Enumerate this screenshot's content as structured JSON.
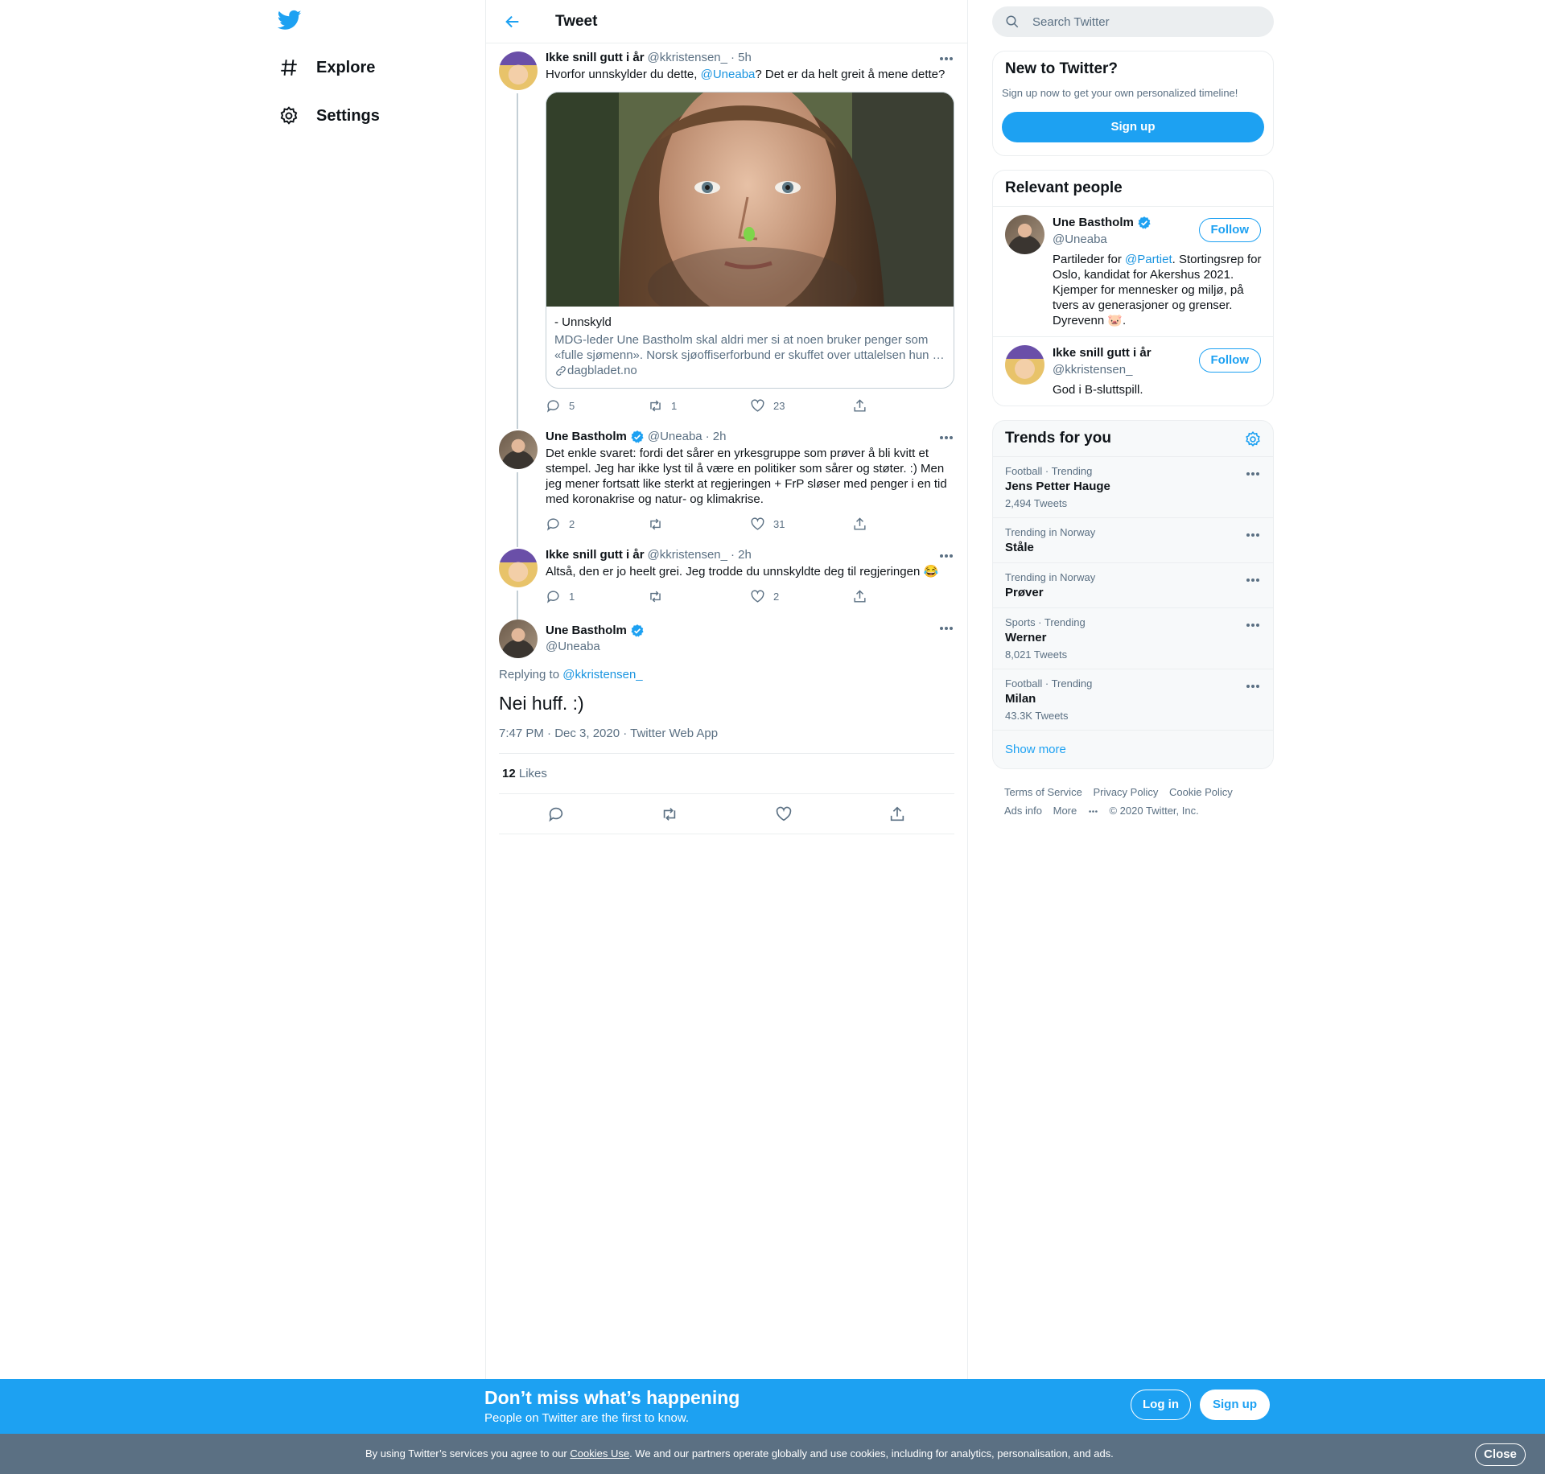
{
  "nav": {
    "explore_label": "Explore",
    "settings_label": "Settings"
  },
  "header": {
    "title": "Tweet"
  },
  "thread": [
    {
      "name": "Ikke snill gutt i år",
      "handle": "@kkristensen_",
      "time": "· 5h",
      "text_before": "Hvorfor unnskylder du dette, ",
      "mention": "@Uneaba",
      "text_after": "? Det er da helt greit å mene dette?",
      "card": {
        "title": "- Unnskyld",
        "description": "MDG-leder Une Bastholm skal aldri mer si at noen bruker penger som «fulle sjømenn». Norsk sjøoffiserforbund er skuffet over uttalelsen hun …",
        "domain": "dagbladet.no"
      },
      "replies": "5",
      "retweets": "1",
      "likes": "23"
    },
    {
      "name": "Une Bastholm",
      "handle": "@Uneaba",
      "time": "· 2h",
      "text": "Det enkle svaret: fordi det sårer en yrkesgruppe som prøver å bli kvitt et stempel. Jeg har ikke lyst til å være en politiker som sårer og støter. :) Men jeg mener fortsatt like sterkt at regjeringen + FrP sløser med penger i en tid med koronakrise og natur- og klimakrise.",
      "replies": "2",
      "retweets": "",
      "likes": "31"
    },
    {
      "name": "Ikke snill gutt i år",
      "handle": "@kkristensen_",
      "time": "· 2h",
      "text": "Altså, den er jo heelt grei. Jeg trodde du unnskyldte deg til regjeringen 😂",
      "replies": "1",
      "retweets": "",
      "likes": "2"
    }
  ],
  "focused": {
    "name": "Une Bastholm",
    "handle": "@Uneaba",
    "replying_prefix": "Replying to ",
    "replying_to": "@kkristensen_",
    "text": "Nei huff. :)",
    "meta": "7:47 PM · Dec 3, 2020 · Twitter Web App",
    "likes_count": "12",
    "likes_label": " Likes"
  },
  "search": {
    "placeholder": "Search Twitter"
  },
  "new_to_twitter": {
    "title": "New to Twitter?",
    "text": "Sign up now to get your own personalized timeline!",
    "button": "Sign up"
  },
  "relevant_people": {
    "title": "Relevant people",
    "people": [
      {
        "name": "Une Bastholm",
        "handle": "@Uneaba",
        "bio_before": "Partileder for ",
        "bio_mention": "@Partiet",
        "bio_after": ". Stortingsrep for Oslo, kandidat for Akershus 2021. Kjemper for mennesker og miljø, på tvers av generasjoner og grenser. Dyrevenn 🐷.",
        "follow": "Follow"
      },
      {
        "name": "Ikke snill gutt i år",
        "handle": "@kkristensen_",
        "bio": "God i B-sluttspill.",
        "follow": "Follow"
      }
    ]
  },
  "trends": {
    "title": "Trends for you",
    "items": [
      {
        "category": "Football · Trending",
        "name": "Jens Petter Hauge",
        "count": "2,494 Tweets"
      },
      {
        "category": "Trending in Norway",
        "name": "Ståle",
        "count": ""
      },
      {
        "category": "Trending in Norway",
        "name": "Prøver",
        "count": ""
      },
      {
        "category": "Sports · Trending",
        "name": "Werner",
        "count": "8,021 Tweets"
      },
      {
        "category": "Football · Trending",
        "name": "Milan",
        "count": "43.3K Tweets"
      }
    ],
    "show_more": "Show more"
  },
  "footer": {
    "terms": "Terms of Service",
    "privacy": "Privacy Policy",
    "cookie": "Cookie Policy",
    "ads": "Ads info",
    "more": "More",
    "copyright": "© 2020 Twitter, Inc."
  },
  "banner": {
    "title": "Don’t miss what’s happening",
    "subtitle": "People on Twitter are the first to know.",
    "login": "Log in",
    "signup": "Sign up"
  },
  "cookie_bar": {
    "text_before": "By using Twitter’s services you agree to our ",
    "link": "Cookies Use",
    "text_after": ". We and our partners operate globally and use cookies, including for analytics, personalisation, and ads.",
    "close": "Close"
  },
  "colors": {
    "accent": "#1da1f2",
    "secondary_text": "#5b7083",
    "banner": "#1da1f2",
    "cookie_bar": "#5b7083"
  }
}
